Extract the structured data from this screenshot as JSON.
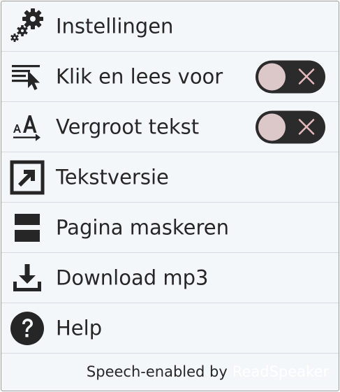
{
  "menu": {
    "items": [
      {
        "id": "settings",
        "label": "Instellingen",
        "icon": "gear-icon"
      },
      {
        "id": "click-and-read",
        "label": "Klik en lees voor",
        "icon": "click-read-icon",
        "toggle": {
          "state": "off",
          "icon": "close-icon"
        }
      },
      {
        "id": "enlarge-text",
        "label": "Vergroot tekst",
        "icon": "enlarge-text-icon",
        "toggle": {
          "state": "off",
          "icon": "close-icon"
        }
      },
      {
        "id": "text-version",
        "label": "Tekstversie",
        "icon": "external-link-icon"
      },
      {
        "id": "page-mask",
        "label": "Pagina maskeren",
        "icon": "page-mask-icon"
      },
      {
        "id": "download-mp3",
        "label": "Download mp3",
        "icon": "download-icon"
      },
      {
        "id": "help",
        "label": "Help",
        "icon": "help-icon"
      }
    ]
  },
  "footer": {
    "text": "Speech-enabled by",
    "brand": "ReadSpeaker"
  },
  "colors": {
    "panel_background": "#f4f7fa",
    "text": "#262626",
    "divider": "#d4dbe3",
    "toggle_track": "#2b2b2b",
    "toggle_knob": "#dcc8c8",
    "toggle_x": "#e3b9bd"
  }
}
